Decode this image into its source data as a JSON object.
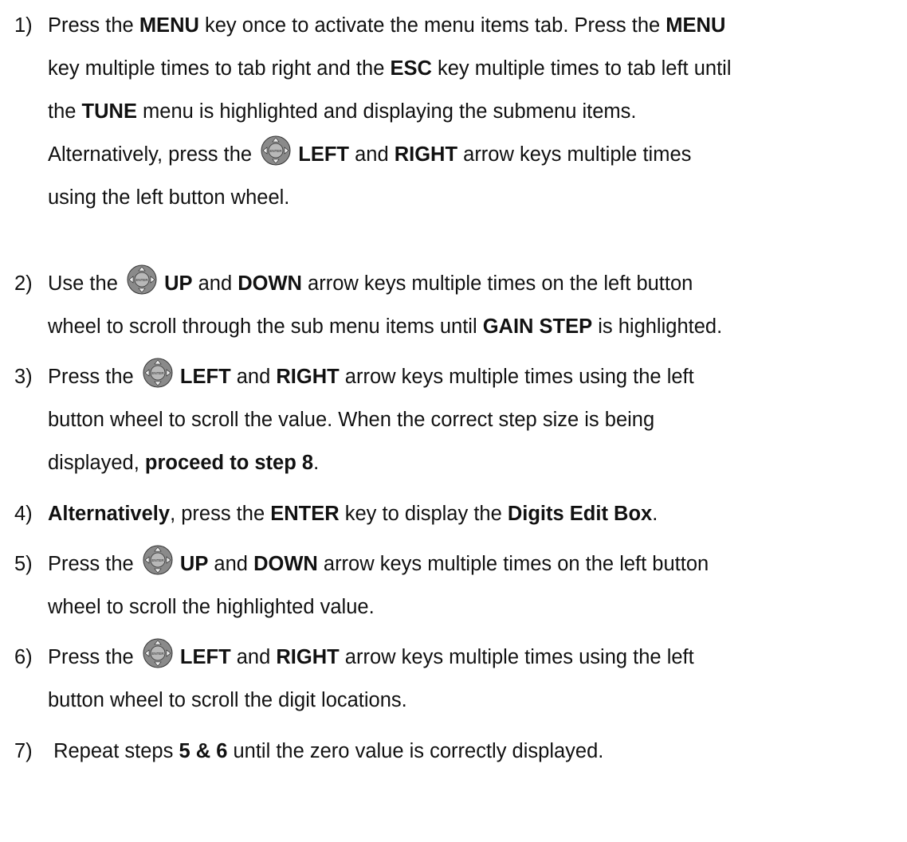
{
  "steps": [
    {
      "number": "1)",
      "lines": [
        [
          {
            "t": "Press the "
          },
          {
            "t": "MENU",
            "b": true
          },
          {
            "t": " key once to activate the menu items tab.  Press the "
          },
          {
            "t": "MENU",
            "b": true
          }
        ],
        [
          {
            "t": "key multiple times to tab right and the "
          },
          {
            "t": "ESC",
            "b": true
          },
          {
            "t": " key multiple times to tab left until"
          }
        ],
        [
          {
            "t": "the "
          },
          {
            "t": "TUNE",
            "b": true
          },
          {
            "t": " menu is highlighted and displaying the submenu items."
          }
        ],
        [
          {
            "t": "Alternatively, press the "
          },
          {
            "icon": "button-wheel-icon"
          },
          {
            "t": " "
          },
          {
            "t": "LEFT",
            "b": true
          },
          {
            "t": " and "
          },
          {
            "t": "RIGHT",
            "b": true
          },
          {
            "t": " arrow keys multiple times"
          }
        ],
        [
          {
            "t": "using the left button wheel."
          }
        ]
      ]
    },
    {
      "number": "2)",
      "lines": [
        [
          {
            "t": "Use the "
          },
          {
            "icon": "button-wheel-icon"
          },
          {
            "t": " "
          },
          {
            "t": "UP",
            "b": true
          },
          {
            "t": " and "
          },
          {
            "t": "DOWN",
            "b": true
          },
          {
            "t": " arrow keys multiple times on the left button"
          }
        ],
        [
          {
            "t": "wheel to scroll through the sub menu items until "
          },
          {
            "t": "GAIN STEP",
            "b": true
          },
          {
            "t": " is highlighted."
          }
        ]
      ]
    },
    {
      "number": "3)",
      "lines": [
        [
          {
            "t": "Press the "
          },
          {
            "icon": "button-wheel-icon"
          },
          {
            "t": " "
          },
          {
            "t": "LEFT",
            "b": true
          },
          {
            "t": " and "
          },
          {
            "t": "RIGHT",
            "b": true
          },
          {
            "t": " arrow keys multiple times using the left"
          }
        ],
        [
          {
            "t": "button wheel to scroll the value.  When the correct step size is being"
          }
        ],
        [
          {
            "t": "displayed, "
          },
          {
            "t": "proceed to step 8",
            "b": true
          },
          {
            "t": "."
          }
        ]
      ]
    },
    {
      "number": "4)",
      "lines": [
        [
          {
            "t": "Alternatively",
            "b": true
          },
          {
            "t": ", press the "
          },
          {
            "t": "ENTER",
            "b": true
          },
          {
            "t": " key to display the "
          },
          {
            "t": "Digits Edit Box",
            "b": true
          },
          {
            "t": "."
          }
        ]
      ]
    },
    {
      "number": "5)",
      "lines": [
        [
          {
            "t": "Press the "
          },
          {
            "icon": "button-wheel-icon"
          },
          {
            "t": " "
          },
          {
            "t": "UP",
            "b": true
          },
          {
            "t": " and "
          },
          {
            "t": "DOWN",
            "b": true
          },
          {
            "t": " arrow keys multiple times on the left button"
          }
        ],
        [
          {
            "t": "wheel to scroll the highlighted value."
          }
        ]
      ]
    },
    {
      "number": "6)",
      "lines": [
        [
          {
            "t": "Press the "
          },
          {
            "icon": "button-wheel-icon"
          },
          {
            "t": " "
          },
          {
            "t": "LEFT",
            "b": true
          },
          {
            "t": " and "
          },
          {
            "t": "RIGHT",
            "b": true
          },
          {
            "t": " arrow keys multiple times using the left"
          }
        ],
        [
          {
            "t": "button wheel to scroll the digit locations."
          }
        ]
      ]
    },
    {
      "number": "7)",
      "lines": [
        [
          {
            "t": " Repeat steps "
          },
          {
            "t": "5 & 6",
            "b": true
          },
          {
            "t": " until the zero value is correctly displayed."
          }
        ]
      ]
    }
  ],
  "icon_wheel": {
    "center_label": "ENTER",
    "ring_color": "#8a8a8a",
    "center_color": "#b8b8b8"
  }
}
